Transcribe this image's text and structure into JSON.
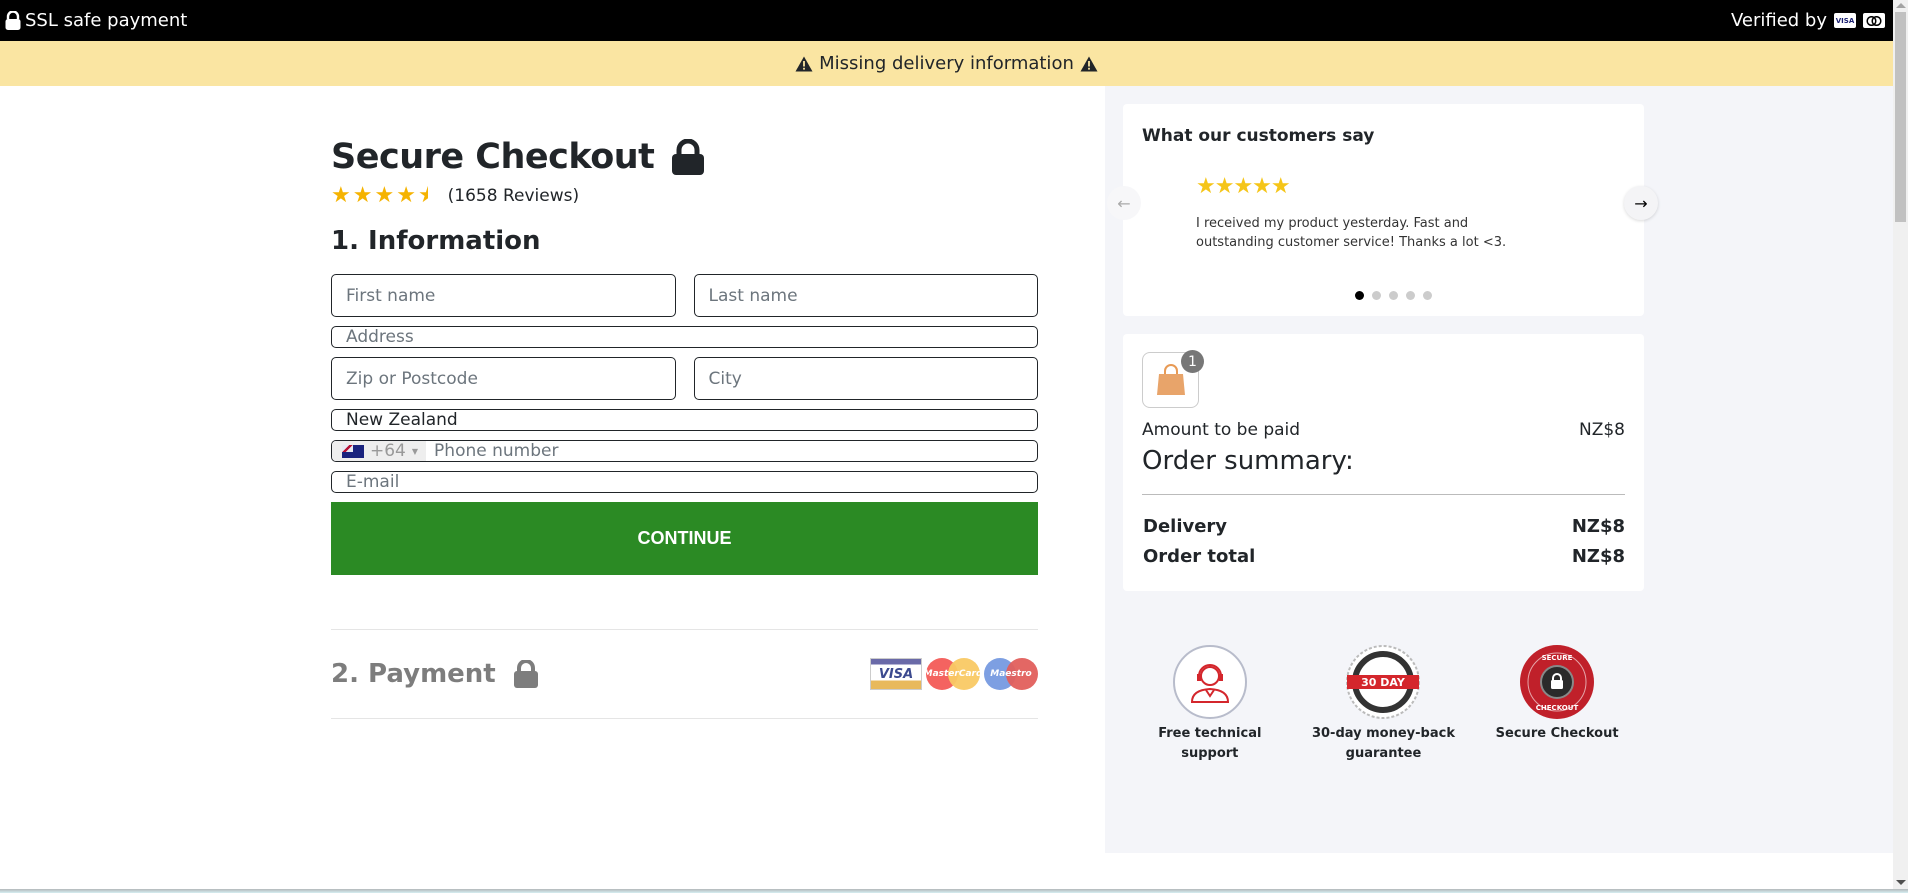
{
  "topbar": {
    "ssl_label": "SSL safe payment",
    "verified_label": "Verified by",
    "verified_cards": [
      "VISA",
      "Mastercard"
    ]
  },
  "alert": {
    "message": "Missing delivery information"
  },
  "checkout": {
    "title": "Secure Checkout",
    "rating": {
      "stars": 4.5,
      "max": 5,
      "reviews_label": "(1658 Reviews)"
    },
    "section1_title": "1. Information",
    "fields": {
      "first_name_placeholder": "First name",
      "last_name_placeholder": "Last name",
      "address_placeholder": "Address",
      "zip_placeholder": "Zip or Postcode",
      "city_placeholder": "City",
      "country_value": "New Zealand",
      "phone_code": "+64",
      "phone_placeholder": "Phone number",
      "email_placeholder": "E-mail"
    },
    "continue_label": "CONTINUE",
    "section2_title": "2. Payment",
    "payment_cards": [
      "VISA",
      "MasterCard",
      "Maestro"
    ]
  },
  "reviews": {
    "title": "What our customers say",
    "stars": 5,
    "text": "I received my product yesterday. Fast and outstanding customer service! Thanks a lot <3.",
    "slide_count": 5,
    "active_slide": 1
  },
  "summary": {
    "cart_count": "1",
    "amount_label": "Amount to be paid",
    "amount_value": "NZ$8",
    "title": "Order summary:",
    "delivery_label": "Delivery",
    "delivery_value": "NZ$8",
    "total_label": "Order total",
    "total_value": "NZ$8"
  },
  "trust": [
    {
      "label": "Free technical support"
    },
    {
      "label": "30-day money-back guarantee",
      "badge_text": "30 DAY"
    },
    {
      "label": "Secure Checkout"
    }
  ],
  "colors": {
    "accent_green": "#2b8a24",
    "alert_bg": "#fae5a2",
    "star": "#f5b301",
    "badge_red": "#c0202a"
  }
}
